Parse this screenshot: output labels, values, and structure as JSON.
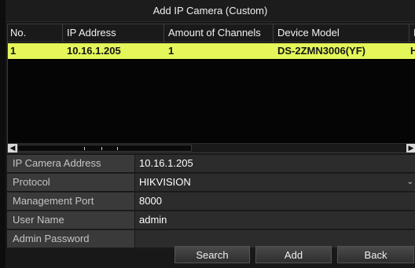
{
  "dialog": {
    "title": "Add IP Camera (Custom)"
  },
  "table": {
    "columns": [
      "No.",
      "IP Address",
      "Amount of Channels",
      "Device Model",
      "P"
    ],
    "rows": [
      {
        "no": "1",
        "ip": "10.16.1.205",
        "channels": "1",
        "model": "DS-2ZMN3006(YF)",
        "extra": "H"
      }
    ],
    "selected_row_color": "#e4f65a"
  },
  "form": {
    "ip_address": {
      "label": "IP Camera Address",
      "value": "10.16.1.205"
    },
    "protocol": {
      "label": "Protocol",
      "value": "HIKVISION"
    },
    "port": {
      "label": "Management Port",
      "value": "8000"
    },
    "username": {
      "label": "User Name",
      "value": "admin"
    },
    "password": {
      "label": "Admin Password",
      "value": ""
    }
  },
  "buttons": {
    "search": "Search",
    "add": "Add",
    "back": "Back"
  },
  "icons": {
    "scroll_left": "◀",
    "scroll_right": "▶",
    "dropdown": "⌄"
  }
}
